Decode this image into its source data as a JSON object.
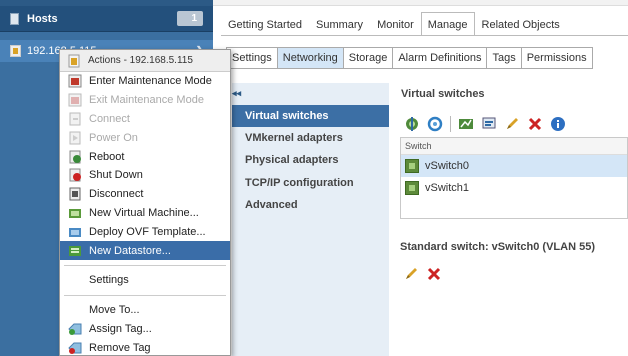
{
  "navigator": {
    "hosts_label": "Hosts",
    "hosts_count": "1",
    "host_label": "192.168.5.115"
  },
  "tabs": [
    "Getting Started",
    "Summary",
    "Monitor",
    "Manage",
    "Related Objects"
  ],
  "active_tab": "Manage",
  "subtabs": [
    "Settings",
    "Networking",
    "Storage",
    "Alarm Definitions",
    "Tags",
    "Permissions"
  ],
  "active_subtab": "Networking",
  "networking_nav": {
    "collapse_icon": "◂◂",
    "items": [
      "Virtual switches",
      "VMkernel adapters",
      "Physical adapters",
      "TCP/IP configuration",
      "Advanced"
    ],
    "active": "Virtual switches"
  },
  "virtual_switches": {
    "title": "Virtual switches",
    "column_header": "Switch",
    "rows": [
      "vSwitch0",
      "vSwitch1"
    ],
    "selected": "vSwitch0"
  },
  "standard_switch": {
    "title": "Standard switch: vSwitch0 (VLAN 55)"
  },
  "context_menu": {
    "header": "Actions - 192.168.5.115",
    "items": [
      {
        "label": "Enter Maintenance Mode",
        "icon": "maintenance-enter-icon",
        "disabled": false
      },
      {
        "label": "Exit Maintenance Mode",
        "icon": "maintenance-exit-icon",
        "disabled": true
      },
      {
        "label": "Connect",
        "icon": "connect-icon",
        "disabled": true
      },
      {
        "label": "Power On",
        "icon": "power-on-icon",
        "disabled": true
      },
      {
        "label": "Reboot",
        "icon": "reboot-icon",
        "disabled": false
      },
      {
        "label": "Shut Down",
        "icon": "shut-down-icon",
        "disabled": false
      },
      {
        "label": "Disconnect",
        "icon": "disconnect-icon",
        "disabled": false
      },
      {
        "label": "New Virtual Machine...",
        "icon": "new-vm-icon",
        "disabled": false
      },
      {
        "label": "Deploy OVF Template...",
        "icon": "deploy-ovf-icon",
        "disabled": false
      },
      {
        "label": "New Datastore...",
        "icon": "new-datastore-icon",
        "disabled": false,
        "highlighted": true
      }
    ],
    "settings_label": "Settings",
    "move_to_label": "Move To...",
    "assign_tag_label": "Assign Tag...",
    "remove_tag_label": "Remove Tag"
  },
  "colors": {
    "navigator_bg": "#3b6fa0",
    "selection_blue": "#3a6da8",
    "delete_red": "#cc2222",
    "edit_yellow": "#d9a227"
  }
}
